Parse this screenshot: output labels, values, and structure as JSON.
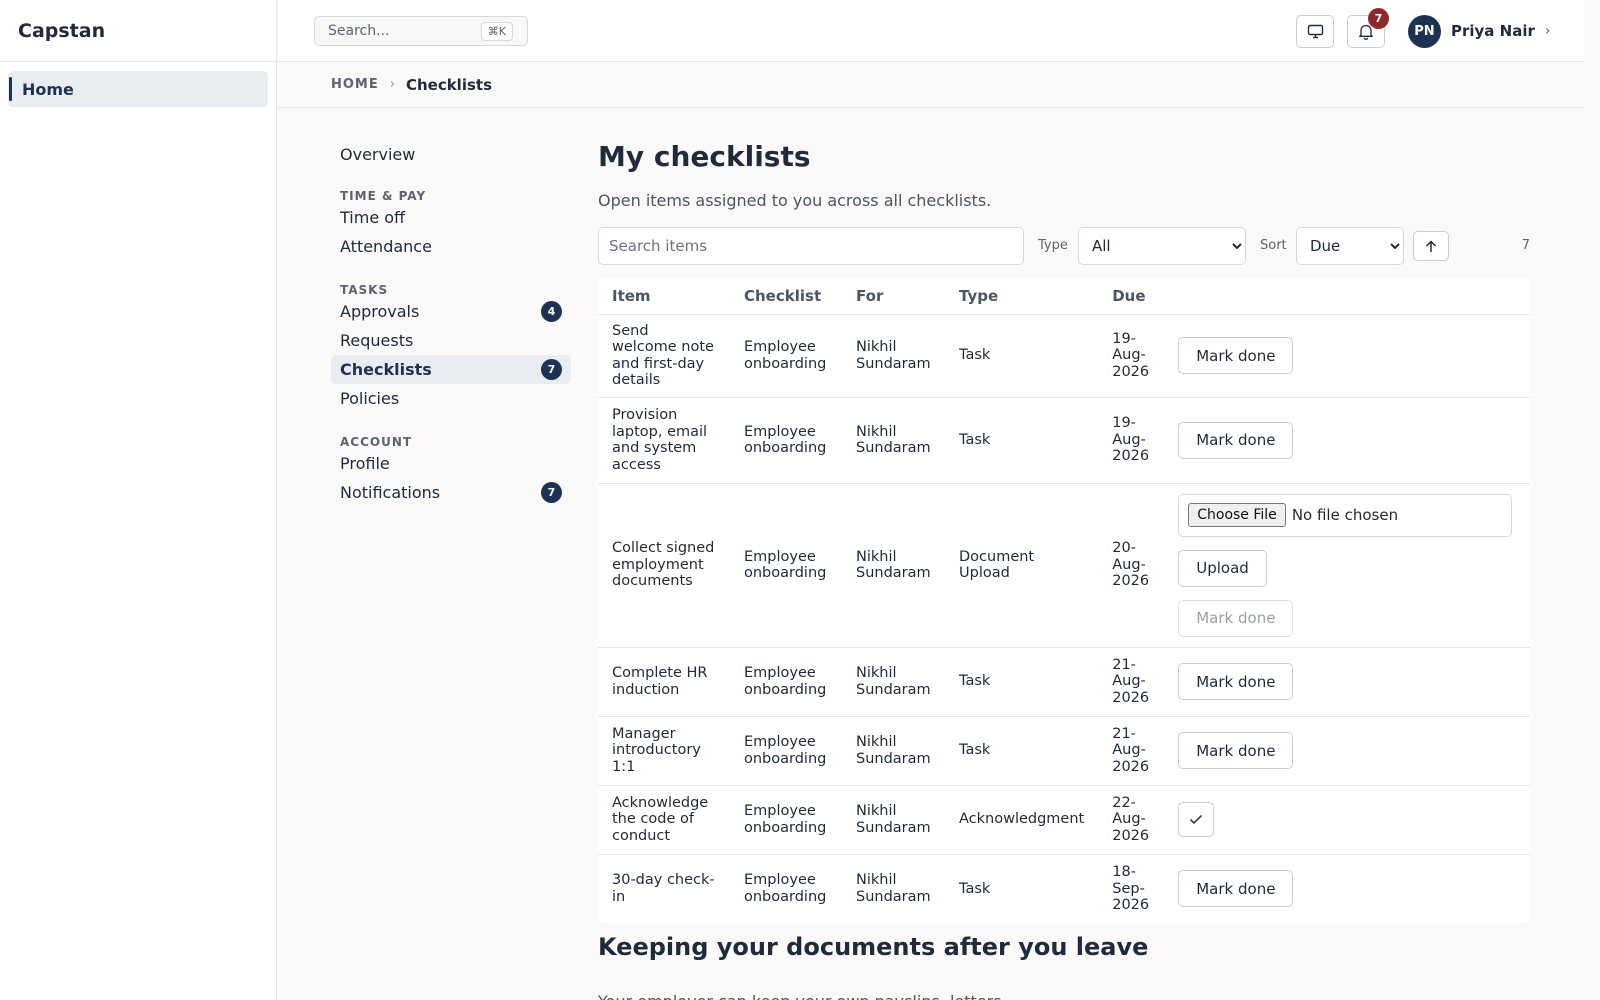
{
  "app": {
    "name": "Capstan",
    "home_label": "Home"
  },
  "topbar": {
    "search_placeholder": "Search...",
    "search_shortcut": "⌘K",
    "notification_count": "7",
    "user": {
      "initials": "PN",
      "name": "Priya Nair"
    }
  },
  "breadcrumb": {
    "home": "HOME",
    "separator": "›",
    "current": "Checklists"
  },
  "subnav": {
    "overview": "Overview",
    "sections": [
      {
        "title": "TIME & PAY"
      },
      {
        "title": "TASKS"
      },
      {
        "title": "ACCOUNT"
      }
    ],
    "time_off": "Time off",
    "attendance": "Attendance",
    "approvals": {
      "label": "Approvals",
      "badge": "4"
    },
    "requests": "Requests",
    "checklists": {
      "label": "Checklists",
      "badge": "7"
    },
    "policies": "Policies",
    "profile": "Profile",
    "notifications": {
      "label": "Notifications",
      "badge": "7"
    }
  },
  "main": {
    "title": "My checklists",
    "subtitle": "Open items assigned to you across all checklists.",
    "search_placeholder": "Search items",
    "type_label": "Type",
    "type_value": "All",
    "sort_label": "Sort",
    "sort_value": "Due",
    "count": "7",
    "columns": [
      "Item",
      "Checklist",
      "For",
      "Type",
      "Due"
    ],
    "mark_done": "Mark done",
    "upload": "Upload",
    "choose_file": "Choose File",
    "no_file": "No file chosen",
    "rows": [
      {
        "item": "Send welcome note and first-day details",
        "checklist": "Employee onboarding",
        "for": "Nikhil Sundaram",
        "type": "Task",
        "due": "19-Aug-2026"
      },
      {
        "item": "Provision laptop, email and system access",
        "checklist": "Employee onboarding",
        "for": "Nikhil Sundaram",
        "type": "Task",
        "due": "19-Aug-2026"
      },
      {
        "item": "Collect signed employment documents",
        "checklist": "Employee onboarding",
        "for": "Nikhil Sundaram",
        "type": "Document Upload",
        "due": "20-Aug-2026"
      },
      {
        "item": "Complete HR induction",
        "checklist": "Employee onboarding",
        "for": "Nikhil Sundaram",
        "type": "Task",
        "due": "21-Aug-2026"
      },
      {
        "item": "Manager introductory 1:1",
        "checklist": "Employee onboarding",
        "for": "Nikhil Sundaram",
        "type": "Task",
        "due": "21-Aug-2026"
      },
      {
        "item": "Acknowledge the code of conduct",
        "checklist": "Employee onboarding",
        "for": "Nikhil Sundaram",
        "type": "Acknowledgment",
        "due": "22-Aug-2026"
      },
      {
        "item": "30-day check-in",
        "checklist": "Employee onboarding",
        "for": "Nikhil Sundaram",
        "type": "Task",
        "due": "18-Sep-2026"
      }
    ],
    "section2_title": "Keeping your documents after you leave",
    "section2_body": "Your employer can keep your own payslips, letters"
  }
}
